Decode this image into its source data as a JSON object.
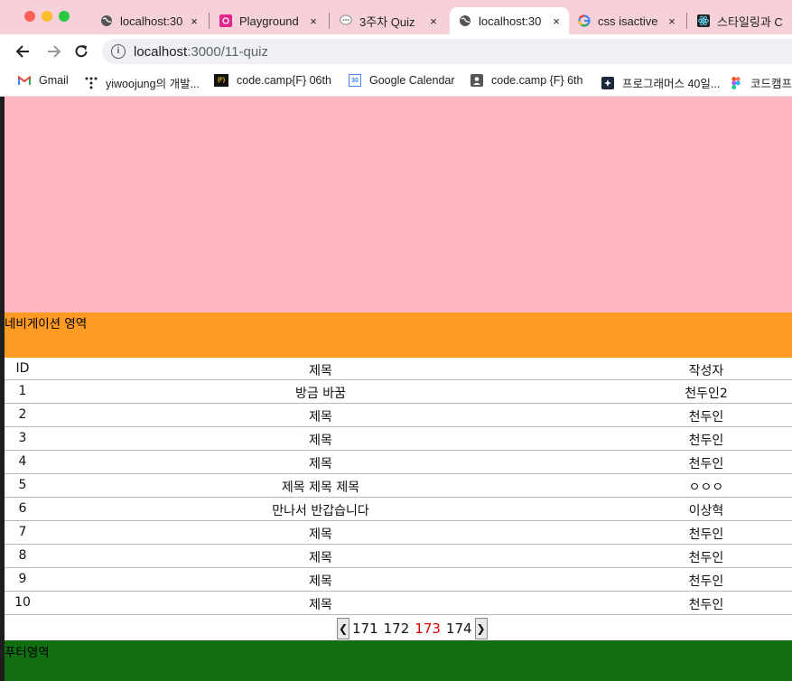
{
  "browser": {
    "tabs": [
      {
        "title": "localhost:30",
        "icon": "globe-icon",
        "active": false
      },
      {
        "title": "Playground",
        "icon": "playground-icon",
        "active": false
      },
      {
        "title": "3주차 Quiz",
        "icon": "chat-bubble-icon",
        "active": false
      },
      {
        "title": "localhost:30",
        "icon": "globe-icon",
        "active": true
      },
      {
        "title": "css isactive",
        "icon": "google-icon",
        "active": false
      },
      {
        "title": "스타일링과 C",
        "icon": "react-icon",
        "active": false
      }
    ],
    "close_glyph": "×",
    "address": {
      "host": "localhost",
      "path": ":3000/11-quiz"
    },
    "bookmarks": [
      {
        "label": "Gmail",
        "icon": "gmail-icon"
      },
      {
        "label": "yiwoojung의 개발...",
        "icon": "dots-icon"
      },
      {
        "label": "code.camp{F} 06th",
        "icon": "codecamp-icon"
      },
      {
        "label": "Google Calendar",
        "icon": "calendar-icon"
      },
      {
        "label": "code.camp {F} 6th",
        "icon": "contact-icon"
      },
      {
        "label": "프로그래머스 40일...",
        "icon": "programmers-icon"
      },
      {
        "label": "코드캠프",
        "icon": "figma-icon"
      }
    ],
    "calendar_day": "30"
  },
  "page": {
    "nav_text": "네비게이션 영역",
    "footer_text": "푸터영역",
    "table": {
      "headers": {
        "id": "ID",
        "title": "제목",
        "writer": "작성자"
      },
      "rows": [
        {
          "id": "1",
          "title": "방금 바꿈",
          "writer": "천두인2"
        },
        {
          "id": "2",
          "title": "제목",
          "writer": "천두인"
        },
        {
          "id": "3",
          "title": "제목",
          "writer": "천두인"
        },
        {
          "id": "4",
          "title": "제목",
          "writer": "천두인"
        },
        {
          "id": "5",
          "title": "제목 제목 제목",
          "writer": "ㅇㅇㅇ"
        },
        {
          "id": "6",
          "title": "만나서 반갑습니다",
          "writer": "이상혁"
        },
        {
          "id": "7",
          "title": "제목",
          "writer": "천두인"
        },
        {
          "id": "8",
          "title": "제목",
          "writer": "천두인"
        },
        {
          "id": "9",
          "title": "제목",
          "writer": "천두인"
        },
        {
          "id": "10",
          "title": "제목",
          "writer": "천두인"
        }
      ]
    },
    "pagination": {
      "prev": "❮",
      "next": "❯",
      "pages": [
        "171",
        "172",
        "173",
        "174"
      ],
      "active": "173"
    }
  },
  "colors": {
    "banner": "#ffb6c1",
    "nav": "#ff9a24",
    "footer": "#116e11",
    "active_page": "#e60000"
  }
}
